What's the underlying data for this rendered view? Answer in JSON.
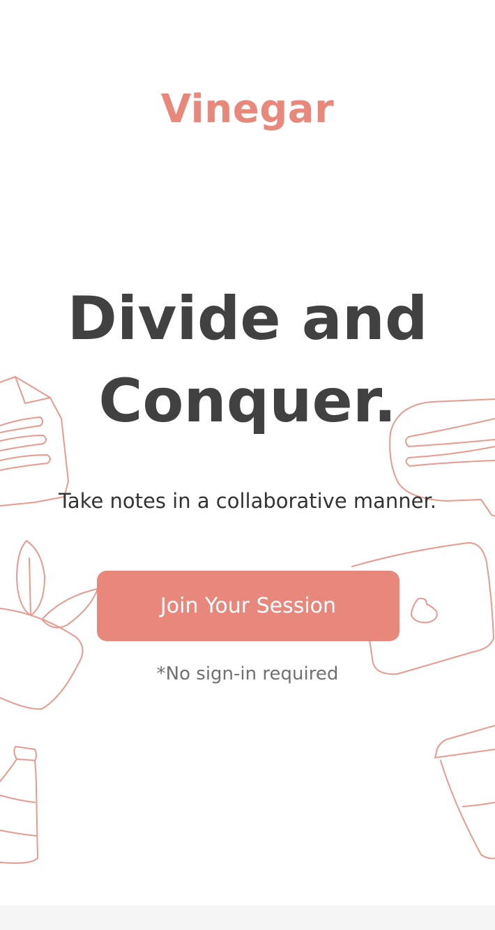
{
  "brand": {
    "name": "Vinegar",
    "accent_color": "#e8877c",
    "doodle_color": "#e89a8f"
  },
  "hero": {
    "headline_line1": "Divide and",
    "headline_line2": "Conquer.",
    "subtitle": "Take notes in a collaborative manner."
  },
  "cta": {
    "join_label": "Join Your Session",
    "note": "*No sign-in required"
  },
  "decorations": [
    "note-paper-doodle",
    "speech-bubble-doodle",
    "leaf-plant-doodle",
    "tablet-doodle",
    "bottle-doodle",
    "cup-doodle"
  ]
}
